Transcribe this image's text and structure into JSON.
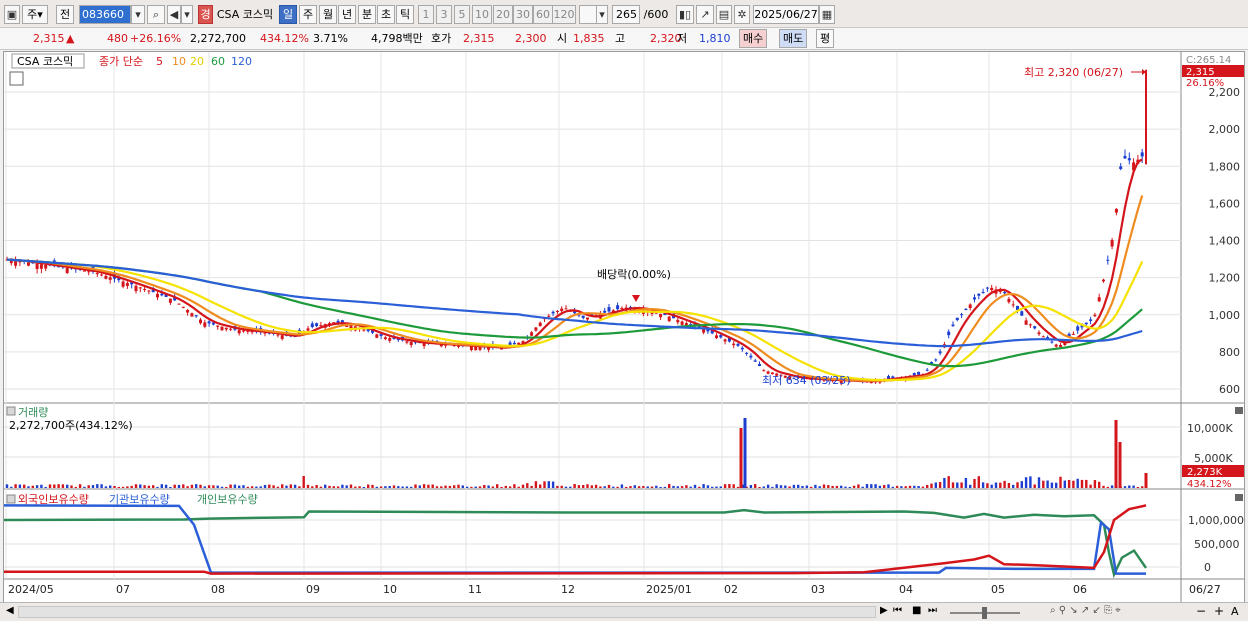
{
  "toolbar": {
    "period_mode": "주",
    "prev_label": "전",
    "stock_code": "083660",
    "market_badge": "경",
    "stock_name": "CSA 코스믹",
    "periods": [
      "일",
      "주",
      "월",
      "년",
      "분",
      "초",
      "틱"
    ],
    "active_period": "일",
    "intervals": [
      "1",
      "3",
      "5",
      "10",
      "20",
      "30",
      "60",
      "120"
    ],
    "count_value": "265",
    "count_total": "/600",
    "date": "2025/06/27"
  },
  "quote": {
    "price": "2,315",
    "change_arrow": "▲",
    "change": "480",
    "change_pct": "+26.16%",
    "volume": "2,272,700",
    "volume_ratio": "434.12%",
    "turnover_pct": "3.71%",
    "amount": "4,798백만",
    "ask_label": "호가",
    "ask": "2,315",
    "bid": "2,300",
    "open_label": "시",
    "open": "1,835",
    "high_label": "고",
    "high": "2,320",
    "low_label": "저",
    "low": "1,810",
    "buy_label": "매수",
    "sell_label": "매도",
    "eval_label": "평"
  },
  "price_panel": {
    "stock_label": "CSA 코스믹",
    "ma_label": "종가 단순",
    "ma_periods": [
      "5",
      "10",
      "20",
      "60",
      "120"
    ],
    "ma_colors": [
      "#d4151b",
      "#ef8c1f",
      "#f5e200",
      "#1d9a3a",
      "#2b5fd8"
    ],
    "top_right_label": "C:265.14",
    "price_tag": "2,315",
    "pct_tag": "26.16%",
    "high_annotation": "최고 2,320 (06/27)",
    "low_annotation": "최저 634 (03/25)",
    "dividend_annotation": "배당락(0.00%)",
    "y_ticks": [
      "2,200",
      "2,000",
      "1,800",
      "1,600",
      "1,400",
      "1,200",
      "1,000",
      "800",
      "600"
    ]
  },
  "volume_panel": {
    "title": "거래량",
    "value_label": "2,272,700주(434.12%)",
    "y_ticks": [
      "10,000K",
      "5,000K"
    ],
    "tag_value": "2,273K",
    "tag_pct": "434.12%"
  },
  "holdings_panel": {
    "series": [
      {
        "name": "외국인보유수량",
        "color": "#d4151b"
      },
      {
        "name": "기관보유수량",
        "color": "#2b5fd8"
      },
      {
        "name": "개인보유수량",
        "color": "#2e8b57"
      }
    ],
    "y_ticks": [
      "1,000,000",
      "500,000",
      "0"
    ]
  },
  "x_axis": {
    "labels": [
      "2024/05",
      "07",
      "08",
      "09",
      "10",
      "11",
      "12",
      "2025/01",
      "02",
      "03",
      "04",
      "05",
      "06",
      "06/27"
    ]
  },
  "colors": {
    "up": "#d4151b",
    "down": "#1d3fd1",
    "grid": "#d8d8d8"
  },
  "chart_data": {
    "type": "candlestick",
    "x": [
      "2024/05",
      "07",
      "08",
      "09",
      "10",
      "11",
      "12",
      "2025/01",
      "02",
      "03",
      "04",
      "05",
      "06",
      "06/27"
    ],
    "close_approx": [
      1300,
      1180,
      920,
      960,
      860,
      820,
      1050,
      1020,
      900,
      650,
      700,
      1150,
      850,
      2315
    ],
    "ylim": [
      600,
      2300
    ],
    "high": 2320,
    "low": 634
  }
}
